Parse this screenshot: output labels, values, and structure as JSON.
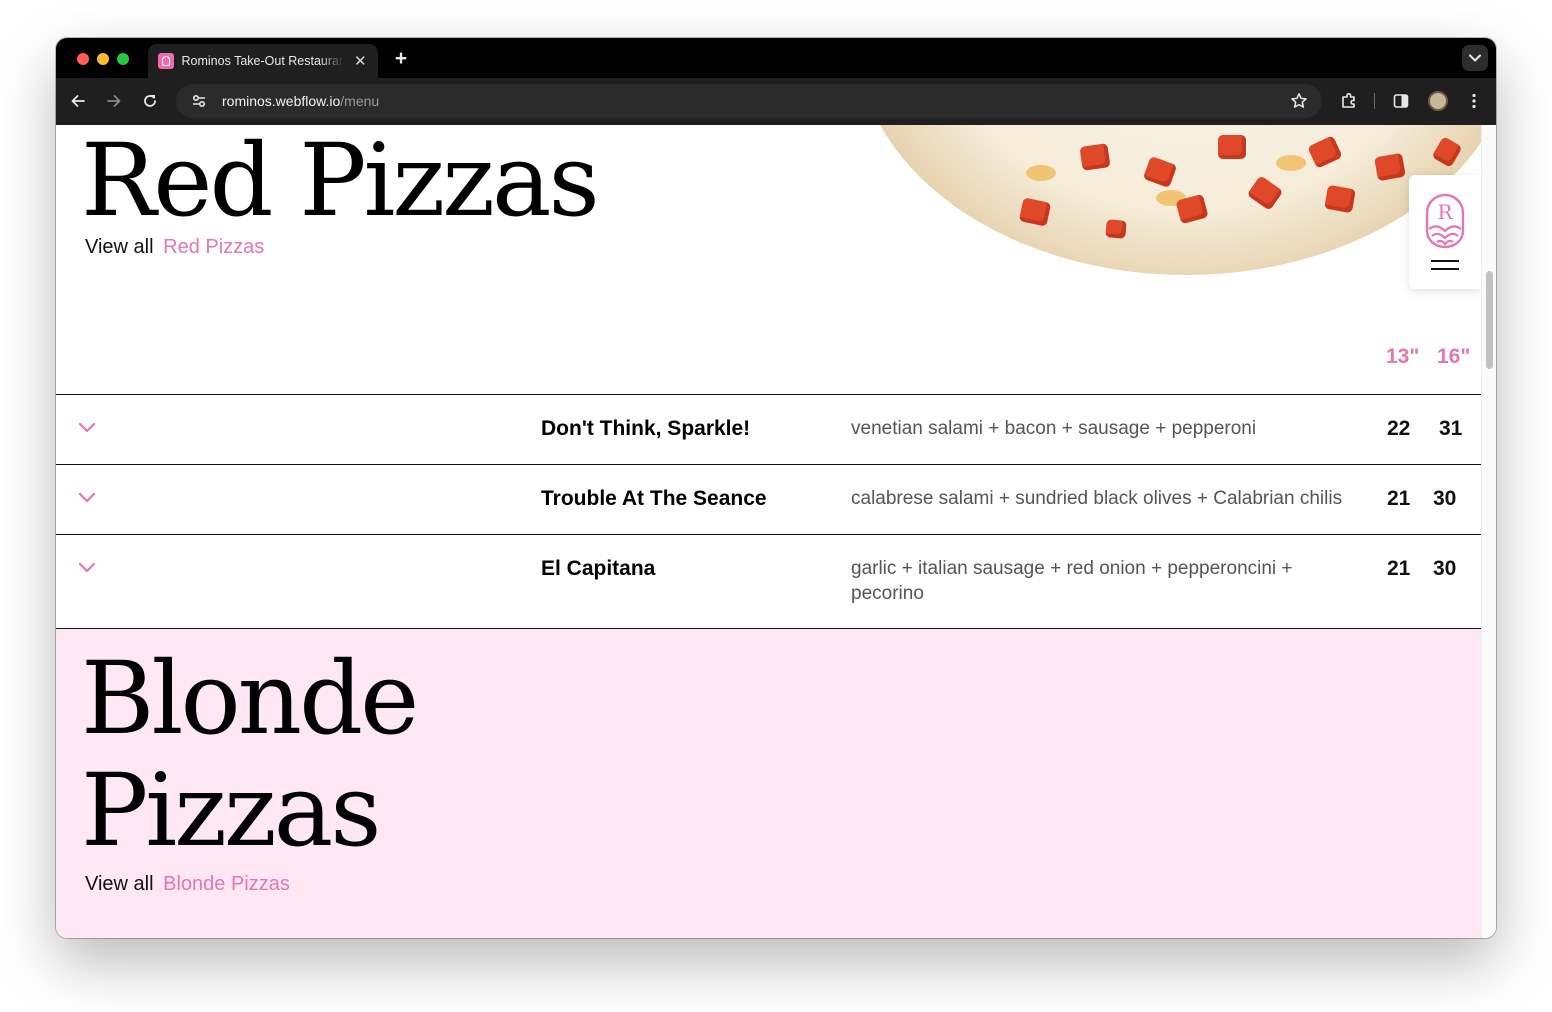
{
  "browser": {
    "tab_title": "Rominos Take-Out Restaurant",
    "url_host": "rominos.webflow.io",
    "url_path": "/menu"
  },
  "colors": {
    "accent_pink": "#e775b4",
    "blonde_bg": "#ffe8f4"
  },
  "red_section": {
    "title": "Red Pizzas",
    "view_all_prefix": "View all",
    "view_all_link": "Red Pizzas",
    "size_small": "13\"",
    "size_large": "16\""
  },
  "menu_items": [
    {
      "name": "Don't Think, Sparkle!",
      "toppings": "venetian salami + bacon + sausage + pepperoni",
      "price_small": "22",
      "price_large": "31"
    },
    {
      "name": "Trouble At The Seance",
      "toppings": "calabrese salami + sundried black olives + Calabrian chilis",
      "price_small": "21",
      "price_large": "30"
    },
    {
      "name": "El Capitana",
      "toppings": "garlic + italian sausage + red onion + pepperoncini + pecorino",
      "price_small": "21",
      "price_large": "30"
    }
  ],
  "blonde_section": {
    "title_line1": "Blonde",
    "title_line2": "Pizzas",
    "view_all_prefix": "View all",
    "view_all_link": "Blonde Pizzas"
  },
  "logo": {
    "letter": "R"
  }
}
